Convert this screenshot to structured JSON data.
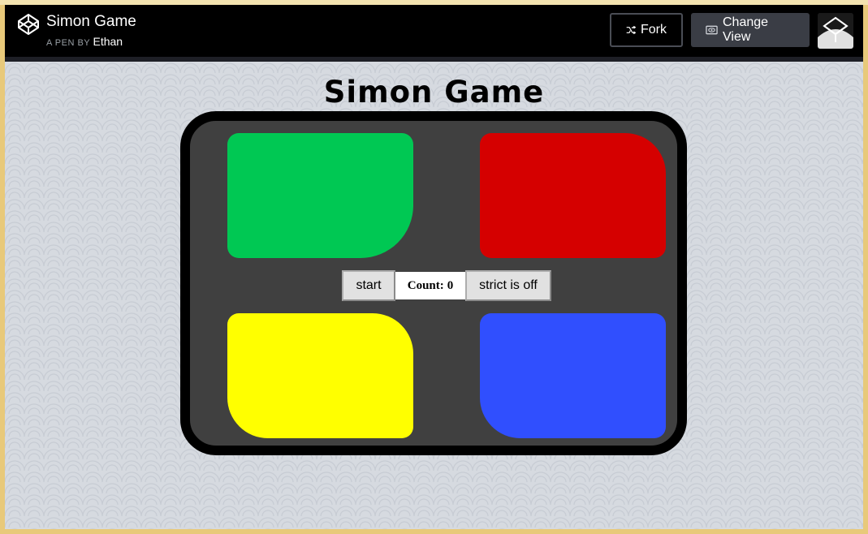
{
  "header": {
    "title": "Simon Game",
    "by_prefix": "A PEN BY",
    "author": "Ethan",
    "fork_label": "Fork",
    "change_view_label": "Change View",
    "logo_icon": "codepen-logo-icon",
    "background": "#000000"
  },
  "game": {
    "title": "Simon Game",
    "start_label": "start",
    "count_label": "Count:",
    "count_value": "0",
    "strict_label": "strict is off",
    "pads": [
      {
        "name": "green",
        "color": "#00c853"
      },
      {
        "name": "red",
        "color": "#d50000"
      },
      {
        "name": "yellow",
        "color": "#ffff00"
      },
      {
        "name": "blue",
        "color": "#304ffe"
      }
    ],
    "board_color": "#404040"
  }
}
